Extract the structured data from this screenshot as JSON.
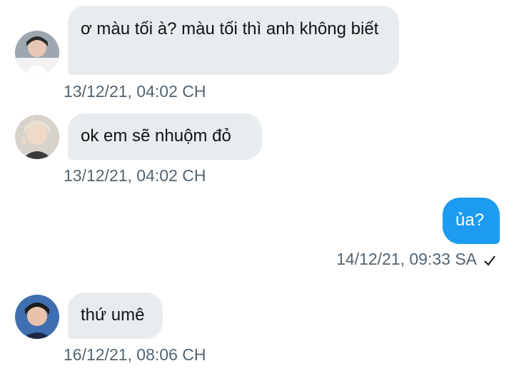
{
  "messages": [
    {
      "direction": "in",
      "text": "ơ màu tối à? màu tối thì anh không biết",
      "timestamp": "13/12/21, 04:02 CH",
      "avatar": "avatar-user-1"
    },
    {
      "direction": "in",
      "text": "ok em sẽ nhuộm đỏ",
      "timestamp": "13/12/21, 04:02 CH",
      "avatar": "avatar-user-2"
    },
    {
      "direction": "out",
      "text": "ủa?",
      "timestamp": "14/12/21, 09:33 SA",
      "status_icon": "check-icon"
    },
    {
      "direction": "in",
      "text": "thứ umê",
      "timestamp": "16/12/21, 08:06 CH",
      "avatar": "avatar-user-3"
    }
  ],
  "colors": {
    "incoming_bubble": "#e8ecef",
    "outgoing_bubble": "#1d9bf0",
    "timestamp": "#536471"
  }
}
